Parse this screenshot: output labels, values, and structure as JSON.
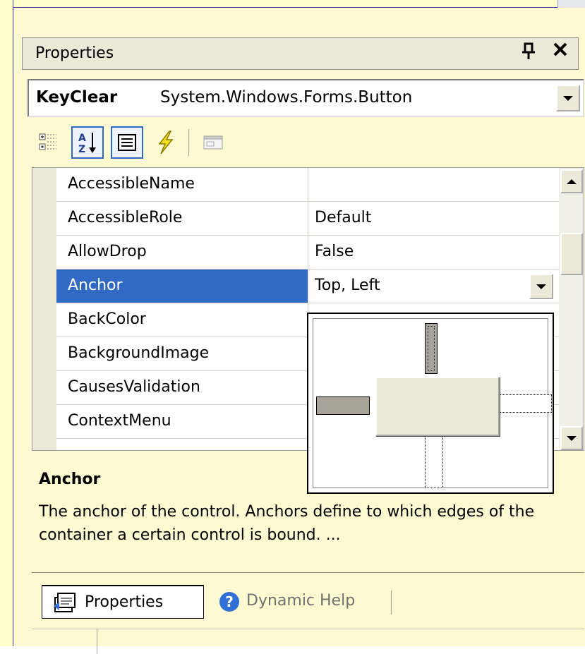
{
  "panel": {
    "title": "Properties",
    "pin_glyph": "ᴞ",
    "close_glyph": "✕"
  },
  "object_selector": {
    "name": "KeyClear",
    "type": "System.Windows.Forms.Button"
  },
  "toolbar": {
    "buttons": [
      "categorized-icon",
      "alphabetical-icon",
      "properties-icon",
      "events-icon",
      "property-pages-icon"
    ],
    "pressed": [
      "alphabetical",
      "properties"
    ]
  },
  "grid": {
    "rows": [
      {
        "name": "AccessibleName",
        "value": ""
      },
      {
        "name": "AccessibleRole",
        "value": "Default"
      },
      {
        "name": "AllowDrop",
        "value": "False"
      },
      {
        "name": "Anchor",
        "value": "Top, Left",
        "selected": true
      },
      {
        "name": "BackColor",
        "value": ""
      },
      {
        "name": "BackgroundImage",
        "value": ""
      },
      {
        "name": "CausesValidation",
        "value": ""
      },
      {
        "name": "ContextMenu",
        "value": ""
      }
    ]
  },
  "anchor_editor": {
    "top": "on",
    "left": "on",
    "right": "off",
    "bottom": "off"
  },
  "description": {
    "heading": "Anchor",
    "text": "The anchor of the control. Anchors define to which edges of the container a certain control is bound. ..."
  },
  "tabs": [
    {
      "label": "Properties",
      "active": true,
      "icon": "properties-page-icon"
    },
    {
      "label": "Dynamic Help",
      "active": false,
      "icon": "help-icon"
    }
  ],
  "colors": {
    "selection": "#316ac5",
    "slide_background": "#fdfad2",
    "control_face": "#ece9d8"
  }
}
